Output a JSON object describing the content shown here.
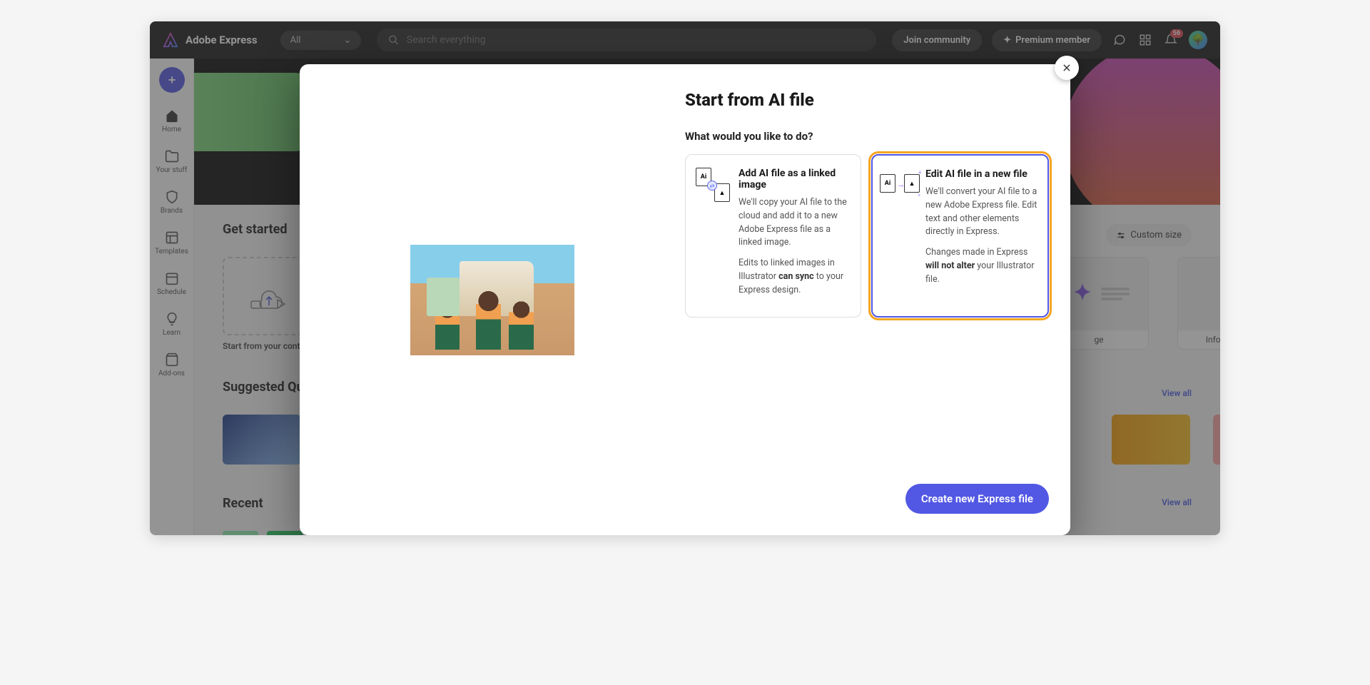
{
  "header": {
    "app_name": "Adobe Express",
    "filter_label": "All",
    "search_placeholder": "Search everything",
    "join_label": "Join community",
    "premium_label": "Premium member",
    "notification_count": "56"
  },
  "sidebar": {
    "items": [
      {
        "label": "Home"
      },
      {
        "label": "Your stuff"
      },
      {
        "label": "Brands"
      },
      {
        "label": "Templates"
      },
      {
        "label": "Schedule"
      },
      {
        "label": "Learn"
      },
      {
        "label": "Add-ons"
      }
    ]
  },
  "main": {
    "get_started_title": "Get started",
    "upload_label": "Start from your content",
    "custom_size_label": "Custom size",
    "template_labels": {
      "infographic": "Infographic",
      "image_partial": "ge"
    },
    "suggested_title": "Suggested Quick",
    "recent_title": "Recent",
    "view_all": "View all"
  },
  "modal": {
    "title": "Start from AI file",
    "subtitle": "What would you like to do?",
    "option1": {
      "title": "Add AI file as a linked image",
      "para1_a": "We'll copy your AI file to the cloud and add it to a new Adobe Express file as a linked image.",
      "para2_a": "Edits to linked images in Illustrator ",
      "para2_bold": "can sync",
      "para2_b": " to your Express design."
    },
    "option2": {
      "title": "Edit AI file in a new file",
      "para1_a": "We'll convert your AI file to a new Adobe Express file. Edit text and other elements directly in Express.",
      "para2_a": "Changes made in Express ",
      "para2_bold": "will not alter",
      "para2_b": " your Illustrator file."
    },
    "create_label": "Create new Express file"
  }
}
